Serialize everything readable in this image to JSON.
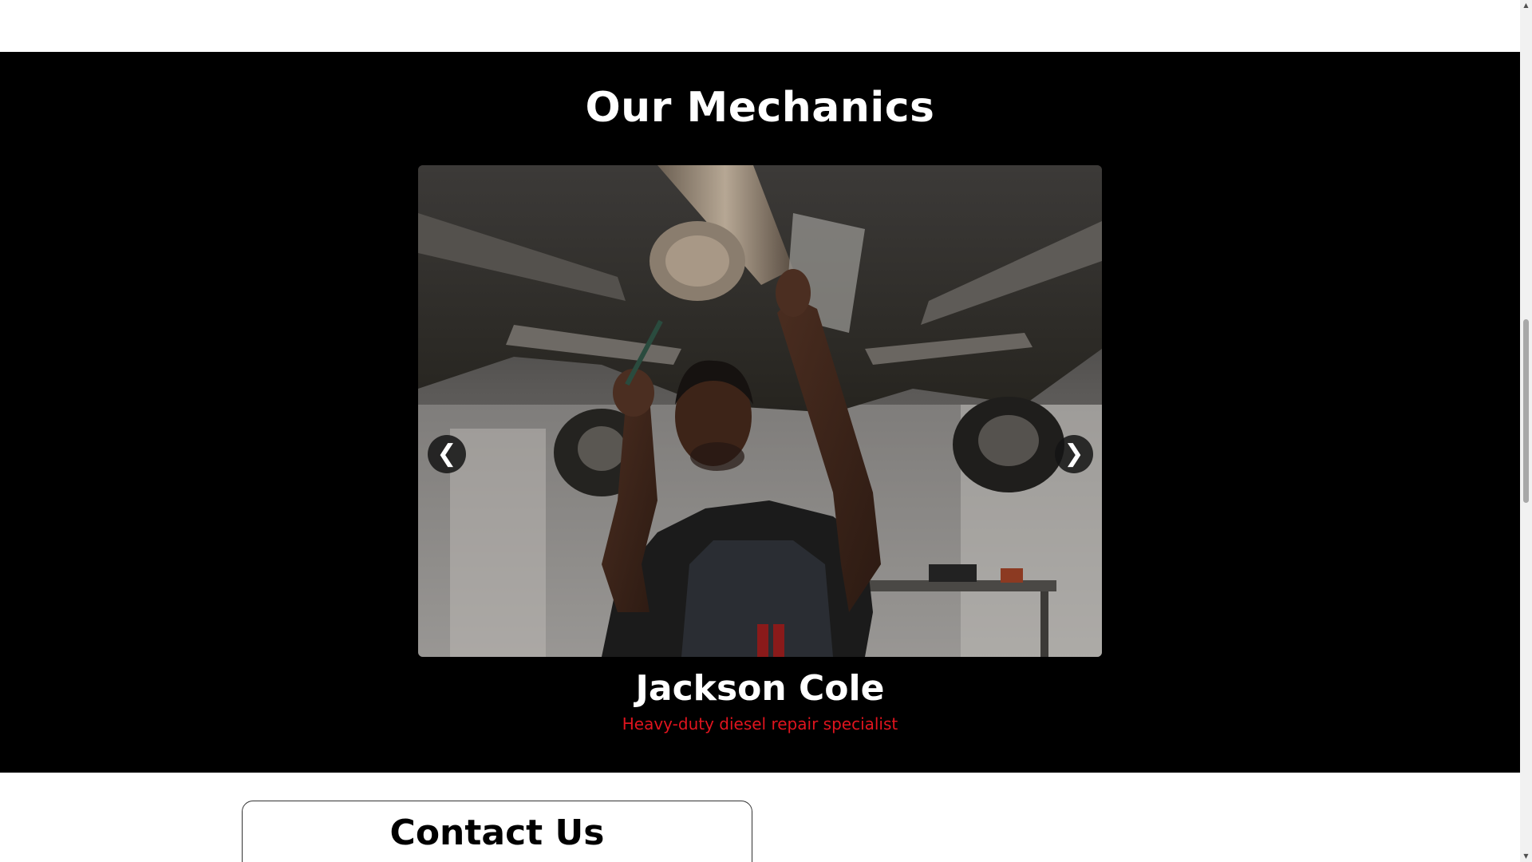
{
  "mechanics_section": {
    "title": "Our Mechanics",
    "carousel": {
      "prev_glyph": "❮",
      "next_glyph": "❯",
      "current": {
        "name": "Jackson Cole",
        "role": "Heavy-duty diesel repair specialist",
        "photo_alt": "Mechanic working under a lifted car"
      }
    }
  },
  "contact_section": {
    "title": "Contact Us"
  },
  "colors": {
    "section_bg": "#000000",
    "accent_red": "#e0141e",
    "text_white": "#ffffff"
  },
  "icons": {
    "prev": "chevron-left-icon",
    "next": "chevron-right-icon"
  }
}
